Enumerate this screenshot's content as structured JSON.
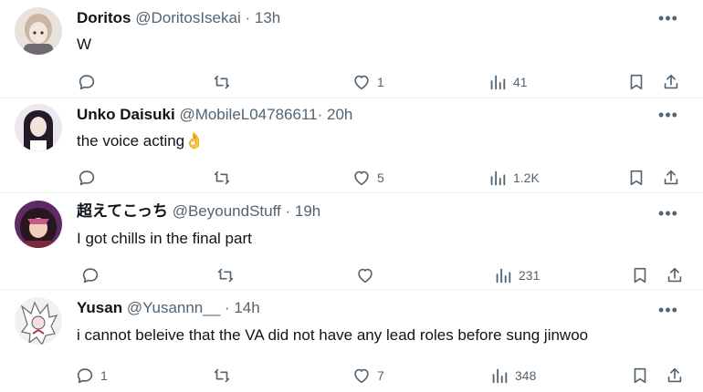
{
  "replies": [
    {
      "name": "Doritos",
      "handle": "@DoritosIsekai",
      "sep": "·",
      "time": "13h",
      "text": "W",
      "emoji": "",
      "replies": "",
      "reposts": "",
      "likes": "1",
      "views": "41",
      "avatar_icon": "anime-girl-avatar",
      "avatar_colors": [
        "#d9c9b8",
        "#8a7a6a"
      ]
    },
    {
      "name": "Unko Daisuki",
      "handle": "@MobileL04786611",
      "sep": "·",
      "time": "20h",
      "text": "the voice acting",
      "emoji": "👌",
      "replies": "",
      "reposts": "",
      "likes": "5",
      "views": "1.2K",
      "avatar_icon": "dark-hair-girl-avatar",
      "avatar_colors": [
        "#e8e4ef",
        "#1f1a24"
      ]
    },
    {
      "name": "超えてこっち",
      "handle": "@BeyoundStuff",
      "sep": "·",
      "time": "19h",
      "text": "I got chills in the final part",
      "emoji": "",
      "replies": "",
      "reposts": "",
      "likes": "",
      "views": "231",
      "avatar_icon": "anime-character-avatar",
      "avatar_colors": [
        "#6b2d6e",
        "#c85a8a"
      ]
    },
    {
      "name": "Yusan",
      "handle": "@Yusannn__",
      "sep": "·",
      "time": "14h",
      "text": "i cannot beleive that the VA did not have any lead roles before sung jinwoo",
      "emoji": "",
      "replies": "1",
      "reposts": "",
      "likes": "7",
      "views": "348",
      "avatar_icon": "manga-character-avatar",
      "avatar_colors": [
        "#f2eef0",
        "#b3414f"
      ]
    }
  ],
  "icons": {
    "more": "more-dots-icon",
    "reply": "reply-bubble-icon",
    "repost": "repost-icon",
    "like": "heart-icon",
    "views": "views-bar-chart-icon",
    "bookmark": "bookmark-icon",
    "share": "share-upload-icon"
  },
  "colors": {
    "text": "#0f1419",
    "muted": "#536471",
    "divider": "#eff3f4"
  }
}
